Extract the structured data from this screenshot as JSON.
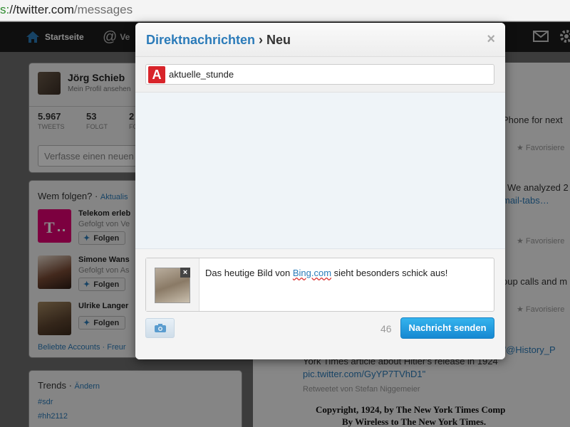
{
  "browser": {
    "url_scheme": "s:",
    "url_host": "//twitter.com",
    "url_path": "/messages"
  },
  "nav": {
    "home_label": "Startseite",
    "connect_label": "Ve"
  },
  "profile": {
    "name": "Jörg Schieb",
    "subtitle": "Mein Profil ansehen",
    "stats": [
      {
        "num": "5.967",
        "label": "TWEETS"
      },
      {
        "num": "53",
        "label": "FOLGT"
      },
      {
        "num": "2",
        "label": "FO"
      }
    ],
    "compose_placeholder": "Verfasse einen neuen"
  },
  "who_to_follow": {
    "title": "Wem folgen?",
    "refresh": "Aktualis",
    "items": [
      {
        "name": "Telekom erleb",
        "by": "Gefolgt von Ve",
        "follow": "Folgen"
      },
      {
        "name": "Simone Wans",
        "by": "Gefolgt von As",
        "follow": "Folgen"
      },
      {
        "name": "Ulrike Langer",
        "by": "",
        "follow": "Folgen"
      }
    ],
    "footer": "Beliebte Accounts · Freur"
  },
  "trends": {
    "title": "Trends",
    "change": "Ändern",
    "items": [
      "#sdr",
      "#hh2112"
    ]
  },
  "timeline": {
    "line1": "Phone for next",
    "fav1": "Favorisiere",
    "line2": "We analyzed 2",
    "link2": "mail-tabs…",
    "fav2": "Favorisiere",
    "line3": "oup calls and m",
    "fav3": "Favorisiere",
    "rt_text": "RT \"@History_P",
    "rt_line2": "York Times article about Hitler's release in 1924",
    "rt_link": "pic.twitter.com/GyYP7TVhD1\"",
    "retweeted_by": "Retweetet von Stefan Niggemeier",
    "newspaper1": "Copyright, 1924, by The New York Times Comp",
    "newspaper2": "By Wireless to The New York Times."
  },
  "modal": {
    "crumb": "Direktnachrichten",
    "separator": " › ",
    "title": "Neu",
    "close": "×",
    "recipient": "aktuelle_stunde",
    "recipient_icon_letter": "A",
    "message_before": "Das heutige Bild von ",
    "message_link": "Bing.com",
    "message_after": " sieht besonders schick aus!",
    "remove_image": "×",
    "char_count": "46",
    "send_label": "Nachricht senden"
  },
  "colors": {
    "link": "#2b7bb9",
    "send_button": "#1e95dd",
    "recipient_icon": "#d8242a"
  }
}
